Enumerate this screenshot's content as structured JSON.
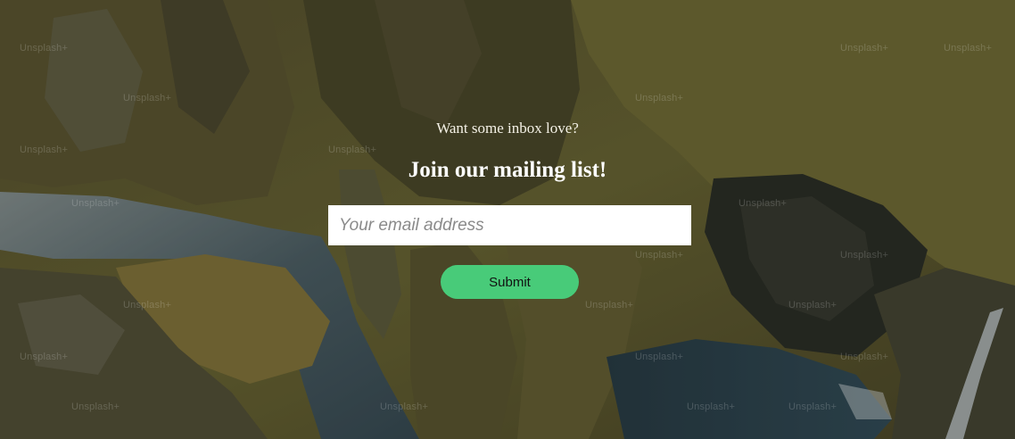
{
  "signup": {
    "kicker": "Want some inbox love?",
    "title": "Join our mailing list!",
    "email_placeholder": "Your email address",
    "email_value": "",
    "submit_label": "Submit"
  },
  "background": {
    "watermark_text": "Unsplash+"
  },
  "colors": {
    "button": "#48cb79",
    "input_bg": "#ffffff",
    "title_text": "#ffffff"
  }
}
